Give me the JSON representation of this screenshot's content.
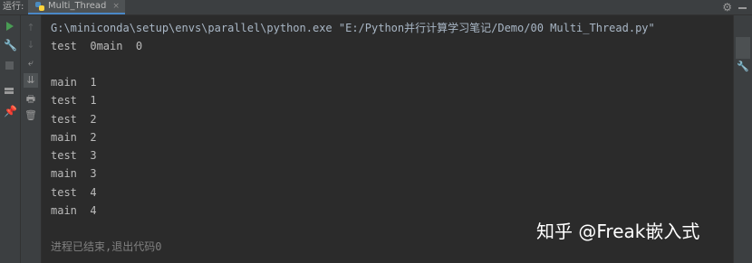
{
  "run_panel": {
    "label": "运行:",
    "tab_title": "Multi_Thread",
    "tab_close": "×"
  },
  "icons": {
    "tab": "python-file-icon",
    "settings": "gear-icon",
    "minimize": "minimize-icon",
    "rerun": "run-icon",
    "up": "arrow-up-icon",
    "down": "arrow-down-icon",
    "wrench": "wrench-icon",
    "wrap": "soft-wrap-icon",
    "stop": "stop-icon",
    "scroll_end": "scroll-to-end-icon",
    "layout": "layout-icon",
    "print": "print-icon",
    "pin": "pin-icon",
    "trash": "trash-icon",
    "right_tool": "wrench-icon"
  },
  "console": {
    "command": "G:\\miniconda\\setup\\envs\\parallel\\python.exe \"E:/Python并行计算学习笔记/Demo/00 Multi_Thread.py\"",
    "output_lines": [
      "test  0main  0",
      "",
      "main  1",
      "test  1",
      "test  2",
      "main  2",
      "test  3",
      "main  3",
      "test  4",
      "main  4"
    ],
    "exit_message": "进程已结束,退出代码0"
  },
  "watermark": "知乎 @Freak嵌入式",
  "colors": {
    "background": "#2b2b2b",
    "toolbar": "#3c3f41",
    "run_green": "#499c54",
    "text": "#bbbbbb",
    "tab_underline": "#4a88c7"
  }
}
